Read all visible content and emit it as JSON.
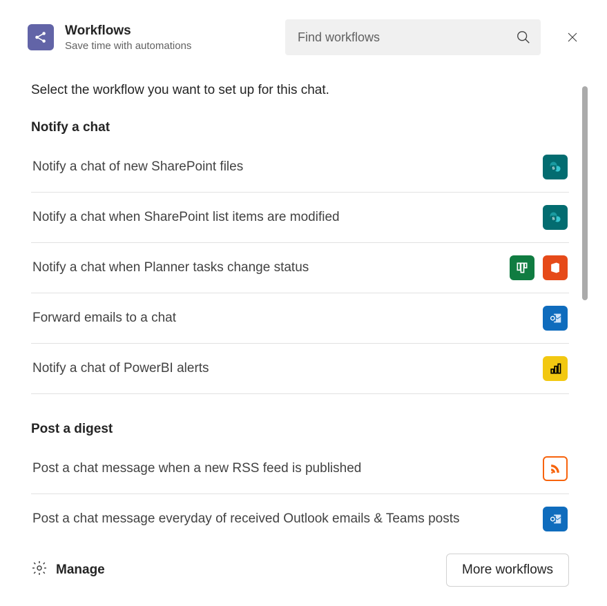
{
  "header": {
    "title": "Workflows",
    "subtitle": "Save time with automations",
    "search_placeholder": "Find workflows"
  },
  "intro": "Select the workflow you want to set up for this chat.",
  "sections": [
    {
      "title": "Notify a chat",
      "items": [
        {
          "label": "Notify a chat of new SharePoint files",
          "icons": [
            "sharepoint"
          ]
        },
        {
          "label": "Notify a chat when SharePoint list items are modified",
          "icons": [
            "sharepoint"
          ]
        },
        {
          "label": "Notify a chat when Planner tasks change status",
          "icons": [
            "planner",
            "office"
          ]
        },
        {
          "label": "Forward emails to a chat",
          "icons": [
            "outlook"
          ]
        },
        {
          "label": "Notify a chat of PowerBI alerts",
          "icons": [
            "powerbi"
          ]
        }
      ]
    },
    {
      "title": "Post a digest",
      "items": [
        {
          "label": "Post a chat message when a new RSS feed is published",
          "icons": [
            "rss"
          ]
        },
        {
          "label": "Post a chat message everyday of received Outlook emails & Teams posts",
          "icons": [
            "outlook"
          ]
        }
      ]
    }
  ],
  "footer": {
    "manage_label": "Manage",
    "more_label": "More workflows"
  }
}
